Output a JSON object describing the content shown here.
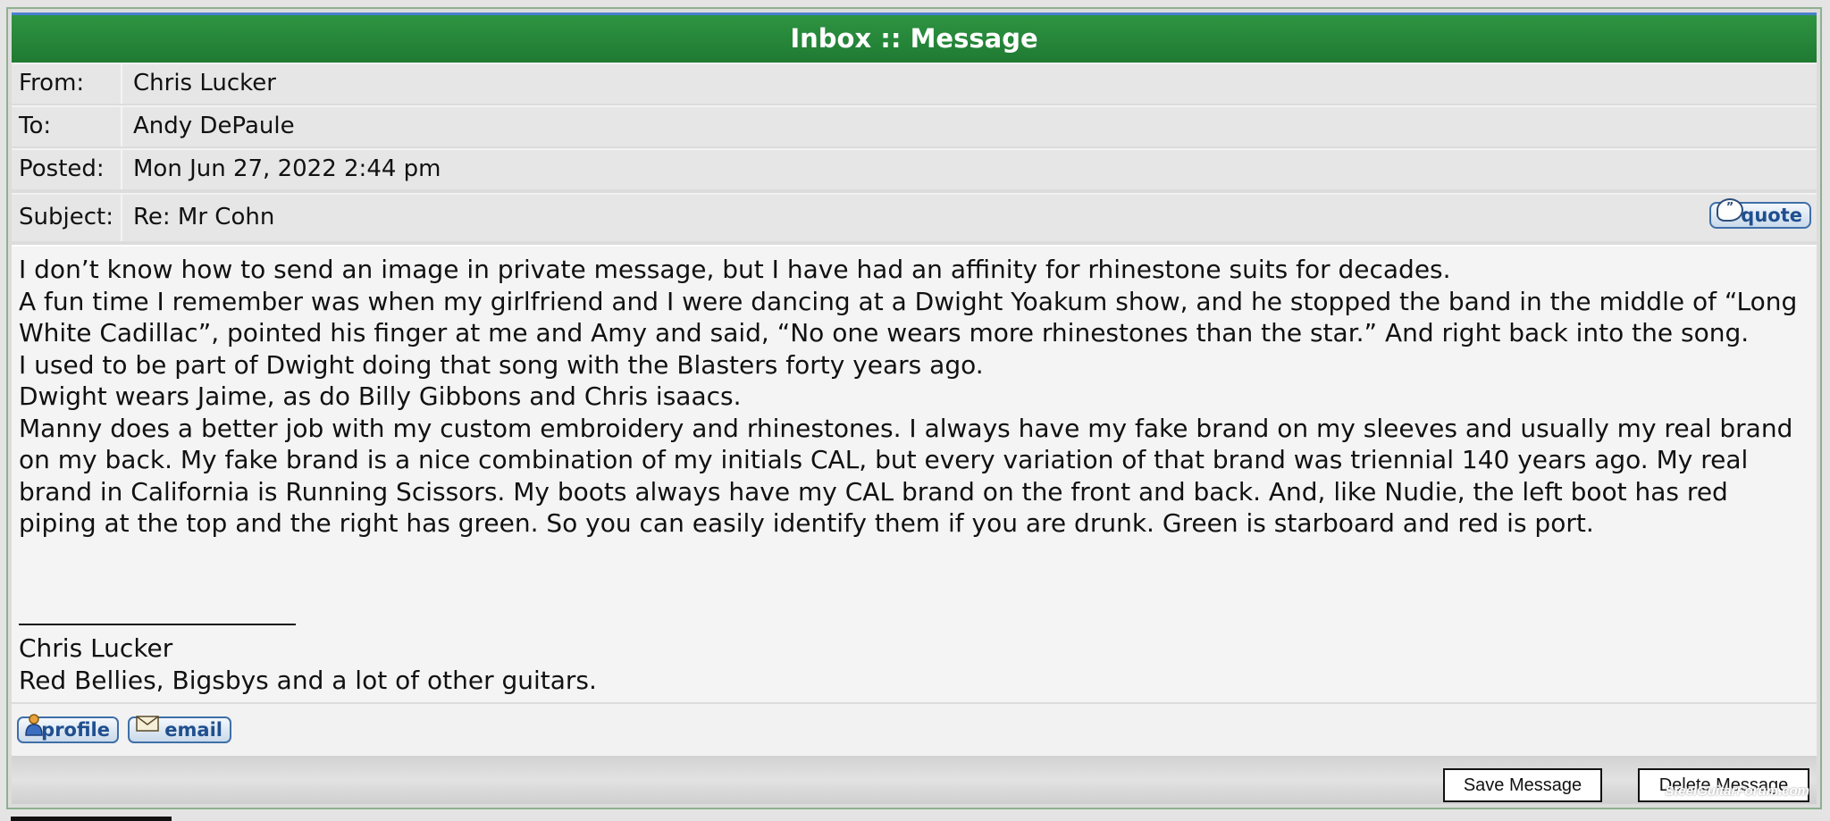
{
  "title": "Inbox :: Message",
  "header": {
    "from_label": "From:",
    "from_value": "Chris Lucker",
    "to_label": "To:",
    "to_value": "Andy DePaule",
    "posted_label": "Posted:",
    "posted_value": "Mon Jun 27, 2022 2:44 pm",
    "subject_label": "Subject:",
    "subject_value": "Re: Mr Cohn",
    "quote_label": "quote"
  },
  "message": {
    "paragraphs": [
      "I don’t know how to send an image in private message, but I have had an affinity for rhinestone suits for decades.",
      "A fun time I remember was when my girlfriend and I were dancing at a Dwight Yoakum show, and he stopped the band in the middle of “Long White Cadillac”, pointed his finger at me and Amy and said, “No one wears more rhinestones than the star.” And right back into the song.",
      "I used to be part of Dwight doing that song with the Blasters forty years ago.",
      "Dwight wears Jaime, as do Billy Gibbons and Chris isaacs.",
      "Manny does a better job with my custom embroidery and rhinestones. I always have my fake brand on my sleeves and usually my real brand on my back. My fake brand is a nice combination of my initials CAL, but every variation of that brand was triennial 140 years ago. My real brand in California is Running Scissors. My boots always have my CAL brand on the front and back. And, like Nudie, the left boot has red piping at the top and the right has green. So you can easily identify them if you are drunk. Green is starboard and red is port."
    ],
    "signature_name": "Chris Lucker",
    "signature_text": "Red Bellies, Bigsbys and a lot of other guitars."
  },
  "profile_buttons": {
    "profile_label": "profile",
    "email_label": "email"
  },
  "actions": {
    "save_label": "Save Message",
    "delete_label": "Delete Message"
  },
  "watermark": "SteelGuitarForum.com",
  "colors": {
    "title_bar": "#1f7a32",
    "button_border": "#3f6fa8",
    "button_text": "#1f4f8f"
  },
  "icons": {
    "quote": "speech-bubble-icon",
    "profile": "person-icon",
    "email": "envelope-icon"
  }
}
